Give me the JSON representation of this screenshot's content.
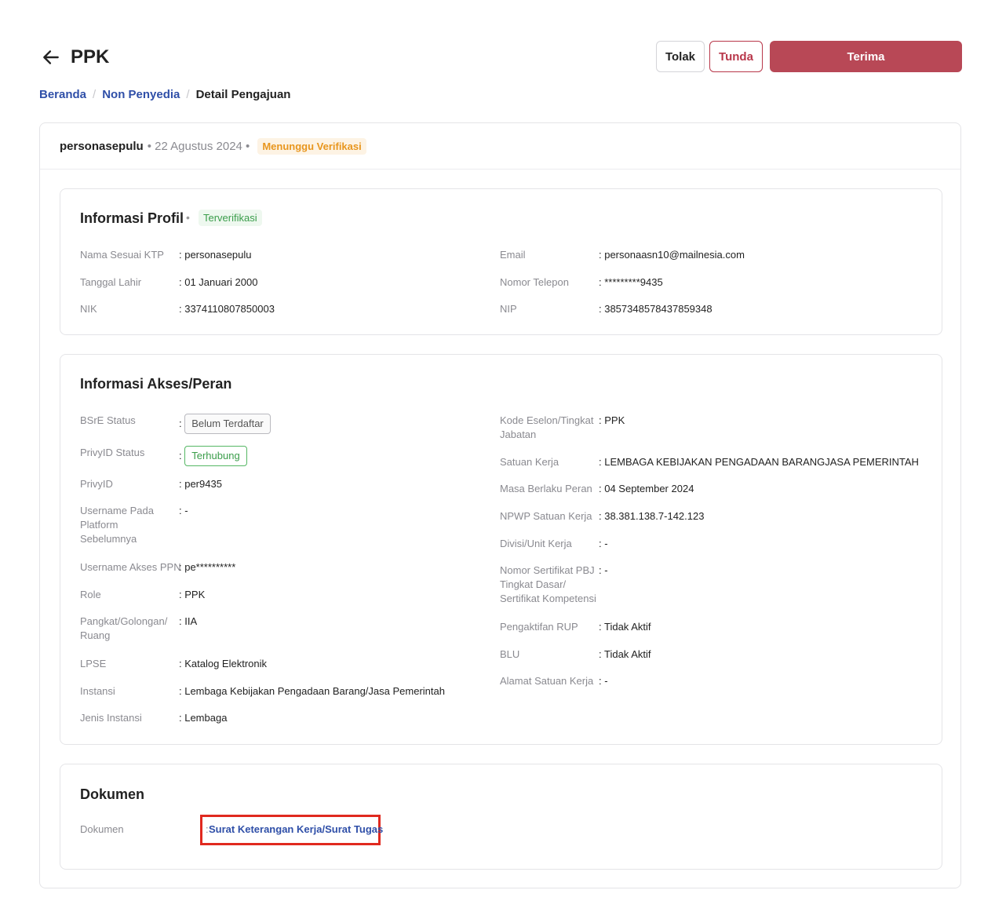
{
  "header": {
    "title": "PPK",
    "buttons": {
      "tolak": "Tolak",
      "tunda": "Tunda",
      "terima": "Terima"
    }
  },
  "breadcrumb": {
    "items": [
      "Beranda",
      "Non Penyedia"
    ],
    "current": "Detail Pengajuan",
    "separator": "/"
  },
  "submission": {
    "username": "personasepulu",
    "date": "• 22 Agustus 2024 •",
    "status": "Menunggu Verifikasi"
  },
  "profile": {
    "title": "Informasi Profil",
    "status": "Terverifikasi",
    "left": [
      {
        "label": "Nama Sesuai KTP",
        "value": ": personasepulu"
      },
      {
        "label": "Tanggal Lahir",
        "value": ": 01 Januari 2000"
      },
      {
        "label": "NIK",
        "value": ": 3374110807850003"
      }
    ],
    "right": [
      {
        "label": "Email",
        "value": ": personaasn10@mailnesia.com"
      },
      {
        "label": "Nomor Telepon",
        "value": ": *********9435"
      },
      {
        "label": "NIP",
        "value": ": 3857348578437859348"
      }
    ]
  },
  "access": {
    "title": "Informasi Akses/Peran",
    "bsre_label": "BSrE Status",
    "bsre_value": "Belum Terdaftar",
    "privy_label": "PrivyID Status",
    "privy_value": "Terhubung",
    "left": [
      {
        "label": "PrivyID",
        "value": ": per9435"
      },
      {
        "label": "Username Pada Platform Sebelumnya",
        "value": ": -"
      },
      {
        "label": "Username Akses PPN",
        "value": ": pe**********"
      },
      {
        "label": "Role",
        "value": ": PPK"
      },
      {
        "label": "Pangkat/Golongan/Ruang",
        "value": ": IIA"
      },
      {
        "label": "LPSE",
        "value": ": Katalog Elektronik"
      },
      {
        "label": "Instansi",
        "value": ": Lembaga Kebijakan Pengadaan Barang/Jasa Pemerintah"
      },
      {
        "label": "Jenis Instansi",
        "value": ": Lembaga"
      }
    ],
    "right": [
      {
        "label": "Kode Eselon/Tingkat Jabatan",
        "value": ": PPK"
      },
      {
        "label": "Satuan Kerja",
        "value": ": LEMBAGA KEBIJAKAN PENGADAAN BARANGJASA PEMERINTAH"
      },
      {
        "label": "Masa Berlaku Peran",
        "value": ": 04 September 2024"
      },
      {
        "label": "NPWP Satuan Kerja",
        "value": ": 38.381.138.7-142.123"
      },
      {
        "label": "Divisi/Unit Kerja",
        "value": ": -"
      },
      {
        "label": "Nomor Sertifikat PBJ Tingkat Dasar/ Sertifikat Kompetensi",
        "value": ": -"
      },
      {
        "label": "Pengaktifan RUP",
        "value": ": Tidak Aktif"
      },
      {
        "label": "BLU",
        "value": ": Tidak Aktif"
      },
      {
        "label": "Alamat Satuan Kerja",
        "value": ": -"
      }
    ]
  },
  "documents": {
    "title": "Dokumen",
    "label": "Dokumen",
    "link": "Surat Keterangan Kerja/Surat Tugas"
  },
  "colors": {
    "primary": "#b84856",
    "link": "#2f4fa8",
    "pending": "#e8961e",
    "verified": "#3a9d4a",
    "highlight": "#e0291f"
  }
}
